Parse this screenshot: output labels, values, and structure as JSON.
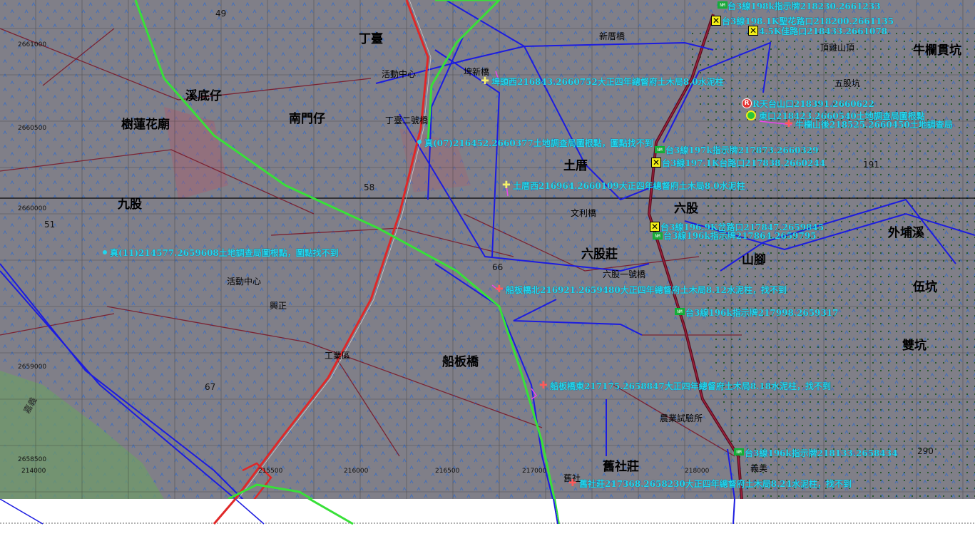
{
  "map": {
    "place_labels": [
      "丁臺",
      "活動中心",
      "埤新橋",
      "新厝橋",
      "樹蓮花廟",
      "溪底仔",
      "南門仔",
      "丁臺二號橋",
      "土厝",
      "六股",
      "文利橋",
      "六股莊",
      "六股一號橋",
      "九股",
      "活動中心",
      "興正",
      "工業區",
      "船板橋",
      "農業試驗所",
      "舊社莊",
      "舊社",
      "山腳",
      "外埔溪",
      "牛欄貫坑",
      "頂雞山頂",
      "五股坑",
      "義美",
      "伍坑",
      "雙坑",
      "嘉義"
    ],
    "grid_labels": [
      "2661000",
      "2660500",
      "2660000",
      "2659000",
      "2658500",
      "214000",
      "215500",
      "216000",
      "216500",
      "217000",
      "218000",
      "49",
      "51",
      "58",
      "66",
      "67",
      "191",
      "290"
    ],
    "annotations": [
      {
        "text": "台3線198k指示牌218230.2661233",
        "color": "#22d5ee",
        "marker": "sign"
      },
      {
        "text": "台3線198.1K聖花路口218200.2661135",
        "color": "#22d5ee",
        "marker": "x"
      },
      {
        "text": "4.5K佳路口218433.2661078",
        "color": "#22d5ee",
        "marker": "x"
      },
      {
        "text": "R天台山口218391.2660622",
        "color": "#22d5ee",
        "marker": "r"
      },
      {
        "text": "東口218423.2660540土地調查局圖根點",
        "color": "#22d5ee",
        "marker": "ring"
      },
      {
        "text": "牛欄山後218525.2660450土地調查局",
        "color": "#22d5ee",
        "marker": "cross"
      },
      {
        "text": "埤頭西216843.2660752大正四年總督府土木局8.0水泥柱",
        "color": "#22d5ee",
        "marker": "ycross"
      },
      {
        "text": "真(07)216452.2660377土地調查局圖根點，圖點找不到",
        "color": "#22d5ee",
        "marker": "dot"
      },
      {
        "text": "台3線197k指示牌217873.2660329",
        "color": "#22d5ee",
        "marker": "sign"
      },
      {
        "text": "台3線197.1K台路口217838.2660244",
        "color": "#22d5ee",
        "marker": "x"
      },
      {
        "text": "土厝西216964.2660109大正四年總督府土木局8.0水泥柱",
        "color": "#22d5ee",
        "marker": "ycross"
      },
      {
        "text": "台3線196.9K岔路口217847.2659845",
        "color": "#22d5ee",
        "marker": "x"
      },
      {
        "text": "台3線196k指示牌217864.2659795",
        "color": "#22d5ee",
        "marker": "sign"
      },
      {
        "text": "真(11)214577.2659608土地調查局圖根點，圖點找不到",
        "color": "#22d5ee",
        "marker": "dot"
      },
      {
        "text": "船板橋北216921.2659480大正四年總督府土木局8.12水泥柱，找不到",
        "color": "#22d5ee",
        "marker": "cross"
      },
      {
        "text": "台3線196k指示牌217998.2659317",
        "color": "#22d5ee",
        "marker": "sign"
      },
      {
        "text": "船板橋東217175.2658847大正四年總督府土木局8.18水泥柱，找不到",
        "color": "#22d5ee",
        "marker": "cross"
      },
      {
        "text": "台3線196k指示牌218133.2658434",
        "color": "#22d5ee",
        "marker": "sign"
      },
      {
        "text": "舊社莊217368.2658230大正四年總督府土木局8.24水泥柱，找不到",
        "color": "#22d5ee",
        "marker": "cross"
      }
    ],
    "colors": {
      "background": "#7f7f86",
      "routes_red": "#e02828",
      "routes_green": "#38e038",
      "routes_blue": "#1c1ce0",
      "road_dark": "#7a1a2a",
      "annotation": "#22d5ee",
      "marker_yellow": "#f2ee18"
    },
    "icons": [
      "sign-icon",
      "crossed-box-icon",
      "cross-icon",
      "dot-icon",
      "r-badge-icon",
      "ring-icon"
    ]
  }
}
